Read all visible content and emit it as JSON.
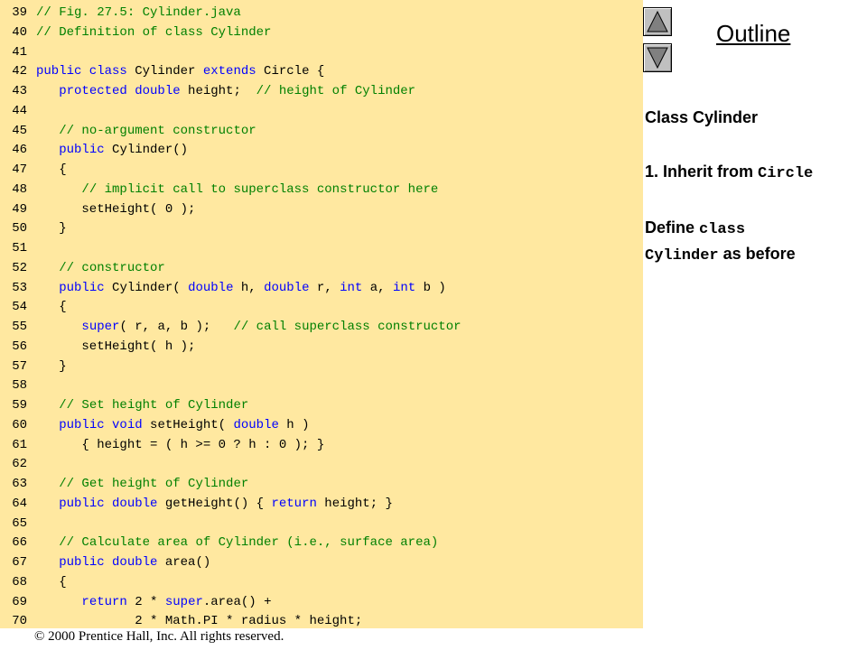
{
  "code_lines": [
    {
      "num": "39",
      "tokens": [
        [
          "c",
          "// Fig. 27.5: Cylinder.java"
        ]
      ]
    },
    {
      "num": "40",
      "tokens": [
        [
          "c",
          "// Definition of class Cylinder"
        ]
      ]
    },
    {
      "num": "41",
      "tokens": []
    },
    {
      "num": "42",
      "tokens": [
        [
          "k",
          "public class"
        ],
        [
          "p",
          " Cylinder "
        ],
        [
          "k",
          "extends"
        ],
        [
          "p",
          " Circle {"
        ]
      ]
    },
    {
      "num": "43",
      "tokens": [
        [
          "p",
          "   "
        ],
        [
          "k",
          "protected double"
        ],
        [
          "p",
          " height;  "
        ],
        [
          "c",
          "// height of Cylinder"
        ]
      ]
    },
    {
      "num": "44",
      "tokens": []
    },
    {
      "num": "45",
      "tokens": [
        [
          "p",
          "   "
        ],
        [
          "c",
          "// no-argument constructor"
        ]
      ]
    },
    {
      "num": "46",
      "tokens": [
        [
          "p",
          "   "
        ],
        [
          "k",
          "public"
        ],
        [
          "p",
          " Cylinder()"
        ]
      ]
    },
    {
      "num": "47",
      "tokens": [
        [
          "p",
          "   {"
        ]
      ]
    },
    {
      "num": "48",
      "tokens": [
        [
          "p",
          "      "
        ],
        [
          "c",
          "// implicit call to superclass constructor here"
        ]
      ]
    },
    {
      "num": "49",
      "tokens": [
        [
          "p",
          "      setHeight( 0 );"
        ]
      ]
    },
    {
      "num": "50",
      "tokens": [
        [
          "p",
          "   }"
        ]
      ]
    },
    {
      "num": "51",
      "tokens": []
    },
    {
      "num": "52",
      "tokens": [
        [
          "p",
          "   "
        ],
        [
          "c",
          "// constructor"
        ]
      ]
    },
    {
      "num": "53",
      "tokens": [
        [
          "p",
          "   "
        ],
        [
          "k",
          "public"
        ],
        [
          "p",
          " Cylinder( "
        ],
        [
          "k",
          "double"
        ],
        [
          "p",
          " h, "
        ],
        [
          "k",
          "double"
        ],
        [
          "p",
          " r, "
        ],
        [
          "k",
          "int"
        ],
        [
          "p",
          " a, "
        ],
        [
          "k",
          "int"
        ],
        [
          "p",
          " b )"
        ]
      ]
    },
    {
      "num": "54",
      "tokens": [
        [
          "p",
          "   {"
        ]
      ]
    },
    {
      "num": "55",
      "tokens": [
        [
          "p",
          "      "
        ],
        [
          "k",
          "super"
        ],
        [
          "p",
          "( r, a, b );   "
        ],
        [
          "c",
          "// call superclass constructor"
        ]
      ]
    },
    {
      "num": "56",
      "tokens": [
        [
          "p",
          "      setHeight( h );"
        ]
      ]
    },
    {
      "num": "57",
      "tokens": [
        [
          "p",
          "   }"
        ]
      ]
    },
    {
      "num": "58",
      "tokens": []
    },
    {
      "num": "59",
      "tokens": [
        [
          "p",
          "   "
        ],
        [
          "c",
          "// Set height of Cylinder"
        ]
      ]
    },
    {
      "num": "60",
      "tokens": [
        [
          "p",
          "   "
        ],
        [
          "k",
          "public void"
        ],
        [
          "p",
          " setHeight( "
        ],
        [
          "k",
          "double"
        ],
        [
          "p",
          " h )"
        ]
      ]
    },
    {
      "num": "61",
      "tokens": [
        [
          "p",
          "      { height = ( h >= 0 ? h : 0 ); }"
        ]
      ]
    },
    {
      "num": "62",
      "tokens": []
    },
    {
      "num": "63",
      "tokens": [
        [
          "p",
          "   "
        ],
        [
          "c",
          "// Get height of Cylinder"
        ]
      ]
    },
    {
      "num": "64",
      "tokens": [
        [
          "p",
          "   "
        ],
        [
          "k",
          "public double"
        ],
        [
          "p",
          " getHeight() { "
        ],
        [
          "k",
          "return"
        ],
        [
          "p",
          " height; }"
        ]
      ]
    },
    {
      "num": "65",
      "tokens": []
    },
    {
      "num": "66",
      "tokens": [
        [
          "p",
          "   "
        ],
        [
          "c",
          "// Calculate area of Cylinder (i.e., surface area)"
        ]
      ]
    },
    {
      "num": "67",
      "tokens": [
        [
          "p",
          "   "
        ],
        [
          "k",
          "public double"
        ],
        [
          "p",
          " area()"
        ]
      ]
    },
    {
      "num": "68",
      "tokens": [
        [
          "p",
          "   {"
        ]
      ]
    },
    {
      "num": "69",
      "tokens": [
        [
          "p",
          "      "
        ],
        [
          "k",
          "return"
        ],
        [
          "p",
          " 2 * "
        ],
        [
          "k",
          "super"
        ],
        [
          "p",
          ".area() +"
        ]
      ]
    },
    {
      "num": "70",
      "tokens": [
        [
          "p",
          "             2 * Math.PI * radius * height;"
        ]
      ]
    }
  ],
  "sidebar": {
    "outline_label": "Outline",
    "item1": "Class Cylinder",
    "item2_text": "1. Inherit from ",
    "item2_code": "Circle",
    "item3_text1": "Define ",
    "item3_code1": "class",
    "item3_code2": "Cylinder",
    "item3_text2": " as before"
  },
  "nav": {
    "up_icon": "triangle-up-icon",
    "down_icon": "triangle-down-icon"
  },
  "footer": {
    "copyright_symbol": "©",
    "text": " 2000 Prentice Hall, Inc.  All rights reserved."
  },
  "colors": {
    "code_bg": "#ffe8a0",
    "comment": "#008000",
    "keyword": "#0000ff"
  }
}
